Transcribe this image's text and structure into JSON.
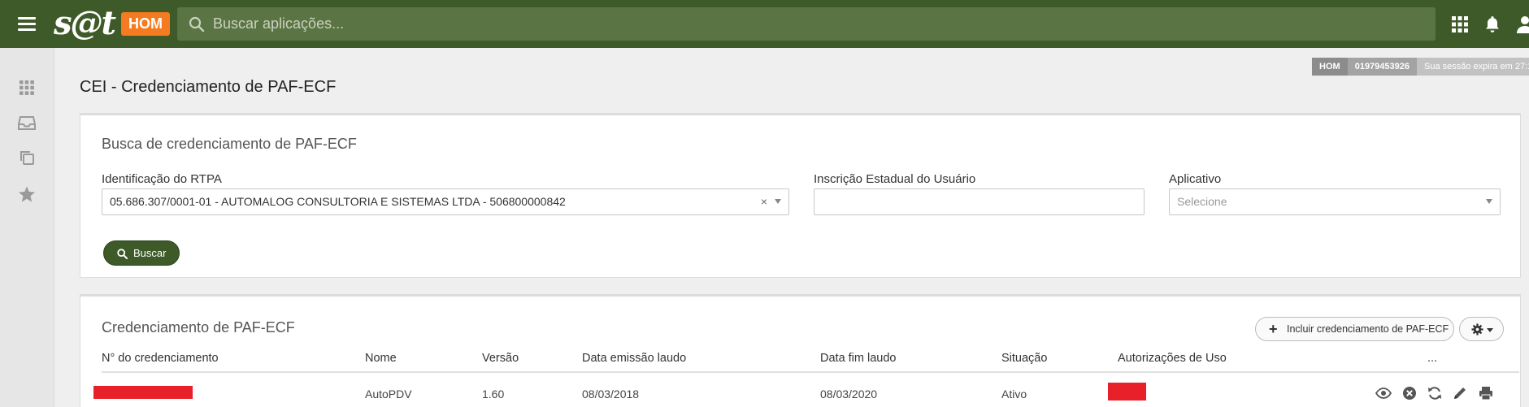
{
  "header": {
    "logo_text": "s@t",
    "env_badge": "HOM",
    "search_placeholder": "Buscar aplicações...",
    "icons": [
      "menu-icon",
      "search-icon",
      "apps-grid-icon",
      "bell-icon",
      "user-icon"
    ]
  },
  "sidebar": {
    "icons": [
      "apps-grid-icon",
      "inbox-icon",
      "copy-icon",
      "star-icon"
    ]
  },
  "session": {
    "env": "HOM",
    "user_id": "01979453926",
    "expire_text": "Sua sessão expira em 27:1"
  },
  "page": {
    "title": "CEI - Credenciamento de PAF-ECF"
  },
  "search_panel": {
    "title": "Busca de credenciamento de PAF-ECF",
    "rtpa_label": "Identificação do RTPA",
    "rtpa_value": "05.686.307/0001-01 - AUTOMALOG CONSULTORIA E SISTEMAS LTDA - 506800000842",
    "clear_glyph": "×",
    "ie_label": "Inscrição Estadual do Usuário",
    "ie_value": "",
    "app_label": "Aplicativo",
    "app_placeholder": "Selecione",
    "search_button": "Buscar"
  },
  "results_panel": {
    "title": "Credenciamento de PAF-ECF",
    "add_button": "Incluir credenciamento de PAF-ECF",
    "add_glyph": "+",
    "columns": [
      "N° do credenciamento",
      "Nome",
      "Versão",
      "Data emissão laudo",
      "Data fim laudo",
      "Situação",
      "Autorizações de Uso",
      "..."
    ],
    "rows": [
      {
        "numero": "",
        "nome": "AutoPDV",
        "versao": "1.60",
        "data_emissao": "08/03/2018",
        "data_fim": "08/03/2020",
        "situacao": "Ativo",
        "autorizacoes": ""
      }
    ],
    "row_actions": [
      "eye-icon",
      "cancel-circle-icon",
      "refresh-icon",
      "pencil-icon",
      "printer-icon"
    ]
  },
  "colors": {
    "primary": "#3d5a28",
    "search_bg": "#5b7444",
    "badge": "#f47b20",
    "redaction": "#e8202a"
  }
}
